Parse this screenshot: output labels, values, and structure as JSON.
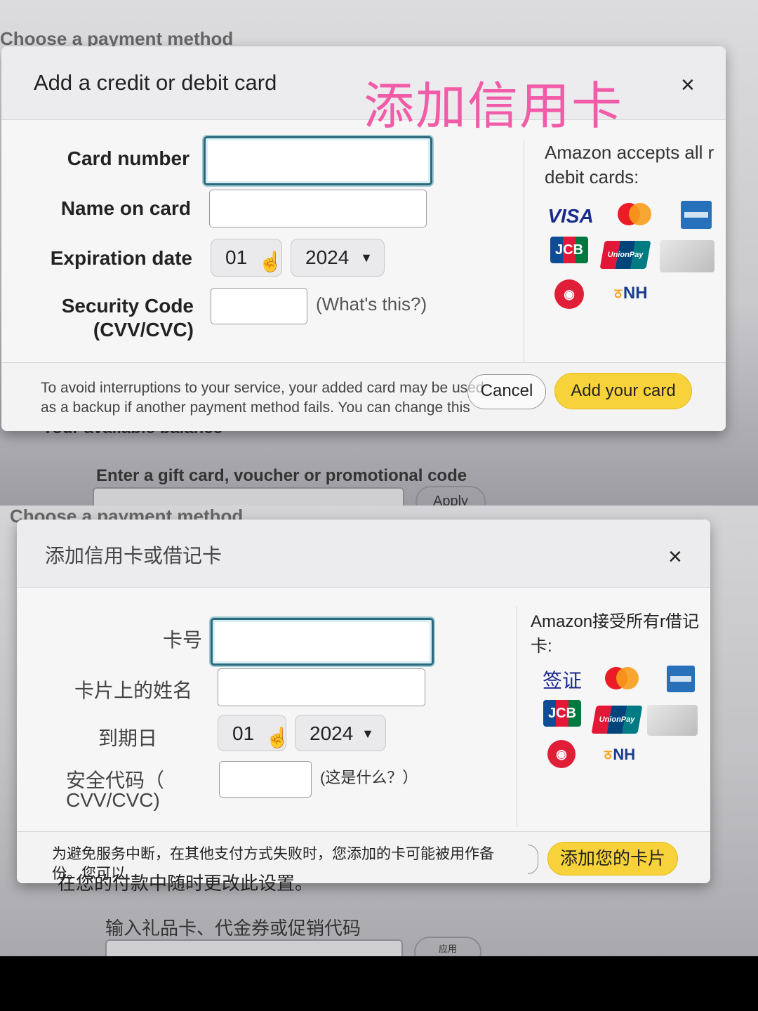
{
  "top": {
    "background": {
      "page_heading": "Choose a payment method",
      "balance_heading": "Your available balance",
      "giftcard_label": "Enter a gift card, voucher or promotional code",
      "apply_label": "Apply"
    },
    "modal": {
      "title": "Add a credit or debit card",
      "overlay_caption": "添加信用卡",
      "close_icon": "×",
      "labels": {
        "card_number": "Card number",
        "name_on_card": "Name on card",
        "expiration_date": "Expiration date",
        "security_code": "Security Code",
        "security_code_sub": "(CVV/CVC)"
      },
      "expiry_month": "01",
      "expiry_year": "2024",
      "whats_this": "(What's this?)",
      "accepts_text": "Amazon accepts all r debit cards:",
      "footnote": "To avoid interruptions to your service, your added card may be used as a backup if another payment method fails. You can change this setting in Your Payments anytime.",
      "cancel_label": "Cancel",
      "add_label": "Add your card"
    }
  },
  "bottom": {
    "background": {
      "page_heading": "Choose a payment method",
      "giftcard_label": "输入礼品卡、代金券或促销代码",
      "apply_label": "应用"
    },
    "modal": {
      "title": "添加信用卡或借记卡",
      "close_icon": "×",
      "labels": {
        "card_number": "卡号",
        "name_on_card": "卡片上的姓名",
        "expiration_date": "到期日",
        "security_code": "安全代码（",
        "security_code_sub": "CVV/CVC)"
      },
      "expiry_month": "01",
      "expiry_year": "2024",
      "whats_this": "(这是什么？）",
      "accepts_text": "Amazon接受所有r借记卡:",
      "visa_text": "签证",
      "footnote": "为避免服务中断，在其他支付方式失败时，您添加的卡可能被用作备份。您可以",
      "footnote_extra": "在您的付款中随时更改此设置。",
      "add_label": "添加您的卡片"
    }
  },
  "card_brands": {
    "visa": "VISA",
    "jcb": "JCB",
    "unionpay": "UnionPay",
    "nh": "NH"
  }
}
